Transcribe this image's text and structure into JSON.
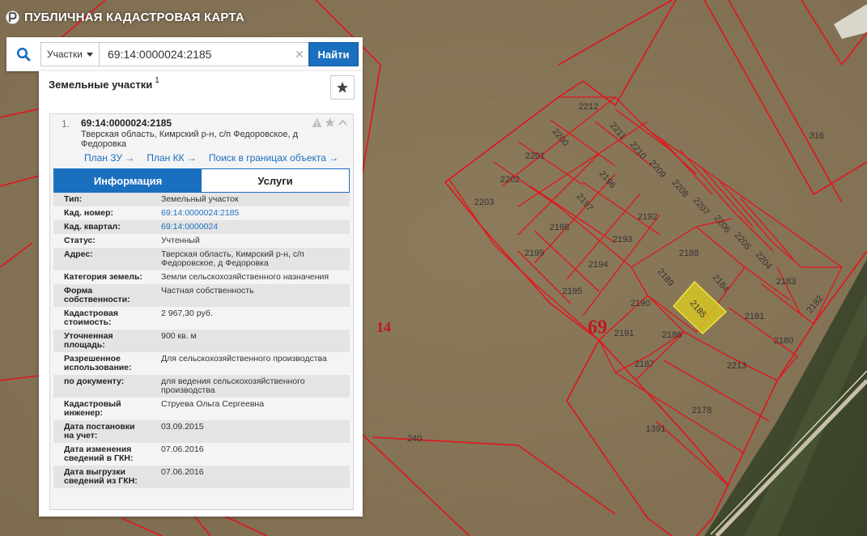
{
  "app": {
    "title": "ПУБЛИЧНАЯ КАДАСТРОВАЯ КАРТА"
  },
  "search": {
    "type_label": "Участки",
    "value": "69:14:0000024:2185",
    "button_label": "Найти"
  },
  "panel": {
    "title": "Земельные участки",
    "count": "1"
  },
  "card": {
    "number": "1.",
    "cad_number": "69:14:0000024:2185",
    "address": "Тверская область, Кимрский р-н, с/п Федоровское, д Федоровка",
    "links": [
      "План ЗУ →",
      "План КК →",
      "Поиск в границах объекта →"
    ],
    "tabs": [
      "Информация",
      "Услуги"
    ],
    "rows": [
      {
        "label": "Тип:",
        "value": "Земельный участок"
      },
      {
        "label": "Кад. номер:",
        "value": "69:14:0000024:2185",
        "link": true
      },
      {
        "label": "Кад. квартал:",
        "value": "69:14:0000024",
        "link": true
      },
      {
        "label": "Статус:",
        "value": "Учтенный"
      },
      {
        "label": "Адрес:",
        "value": "Тверская область, Кимрский р-н, с/п\nФедоровское, д Федоровка"
      },
      {
        "label": "Категория земель:",
        "value": "Земли сельскохозяйственного назначения"
      },
      {
        "label": "Форма\nсобственности:",
        "value": "Частная собственность"
      },
      {
        "label": "Кадастровая\nстоимость:",
        "value": "2 967,30 руб."
      },
      {
        "label": "Уточненная\nплощадь:",
        "value": "900 кв. м"
      },
      {
        "label": "Разрешенное\nиспользование:",
        "value": "Для сельскохозяйственного производства"
      },
      {
        "label": "по документу:",
        "value": "для ведения сельскохозяйственного\nпроизводства"
      },
      {
        "label": "Кадастровый\nинженер:",
        "value": "Струева Ольга Сергеевна"
      },
      {
        "label": "Дата постановки\nна учет:",
        "value": "03.09.2015"
      },
      {
        "label": "Дата изменения\nсведений в ГКН:",
        "value": "07.06.2016"
      },
      {
        "label": "Дата выгрузки\nсведений из ГКН:",
        "value": "07.06.2016"
      }
    ]
  },
  "map": {
    "quarter_labels": [
      "14",
      "69"
    ],
    "plot_labels": [
      "2212",
      "2211",
      "2210",
      "2209",
      "2208",
      "2207",
      "2206",
      "2205",
      "2204",
      "2200",
      "2201",
      "2202",
      "2203",
      "2196",
      "2197",
      "2198",
      "2199",
      "2192",
      "2193",
      "2194",
      "2195",
      "2188",
      "2189",
      "2184",
      "2183",
      "2182",
      "2190",
      "2185",
      "2181",
      "2180",
      "2191",
      "2186",
      "2187",
      "2213",
      "2178",
      "1391",
      "316",
      "240"
    ],
    "selected_plot": "2185",
    "colors": {
      "boundary": "#e3141b",
      "selected_fill": "#e2d21c",
      "field": "#8a7758"
    }
  }
}
